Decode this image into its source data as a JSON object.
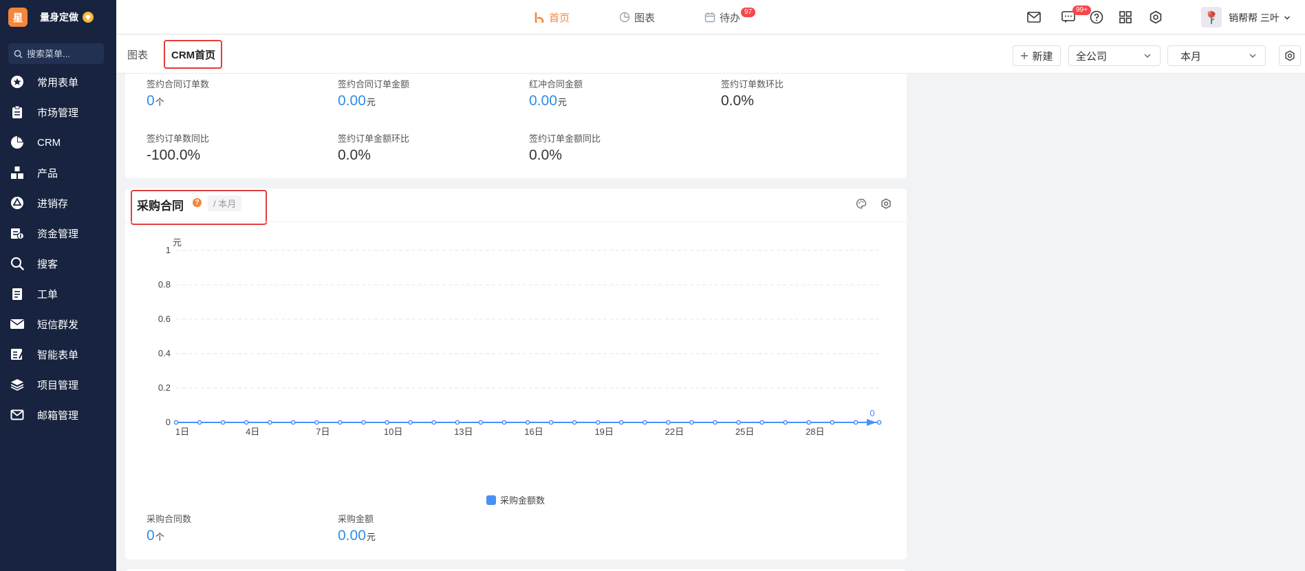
{
  "brand": {
    "logo_char": "星",
    "name": "量身定做"
  },
  "search": {
    "placeholder": "搜索菜单..."
  },
  "sidebar": {
    "items": [
      {
        "label": "常用表单",
        "icon": "star-icon"
      },
      {
        "label": "市场管理",
        "icon": "clipboard-icon"
      },
      {
        "label": "CRM",
        "icon": "pie-icon"
      },
      {
        "label": "产品",
        "icon": "boxes-icon"
      },
      {
        "label": "进销存",
        "icon": "recycle-icon"
      },
      {
        "label": "资金管理",
        "icon": "finance-icon"
      },
      {
        "label": "搜客",
        "icon": "search-icon"
      },
      {
        "label": "工单",
        "icon": "ticket-icon"
      },
      {
        "label": "短信群发",
        "icon": "envelope-icon"
      },
      {
        "label": "智能表单",
        "icon": "form-icon"
      },
      {
        "label": "项目管理",
        "icon": "layers-icon"
      },
      {
        "label": "邮箱管理",
        "icon": "mail-icon"
      }
    ]
  },
  "topnav": {
    "home": "首页",
    "charts": "图表",
    "todo": "待办",
    "todo_badge": "97",
    "message_badge": "99+",
    "user_name": "销帮帮 三叶"
  },
  "subnav": {
    "tab_charts": "图表",
    "tab_crm_home": "CRM首页",
    "new_button": "新建",
    "company_select": "全公司",
    "period_select": "本月"
  },
  "contract_stats": [
    {
      "label": "签约合同订单数",
      "value": "0",
      "unit": "个",
      "highlight": true
    },
    {
      "label": "签约合同订单金额",
      "value": "0.00",
      "unit": "元",
      "highlight": true
    },
    {
      "label": "红冲合同金额",
      "value": "0.00",
      "unit": "元",
      "highlight": true
    },
    {
      "label": "签约订单数环比",
      "value": "0.0%",
      "unit": "",
      "highlight": false
    },
    {
      "label": "签约订单数同比",
      "value": "-100.0%",
      "unit": "",
      "highlight": false
    },
    {
      "label": "签约订单金额环比",
      "value": "0.0%",
      "unit": "",
      "highlight": false
    },
    {
      "label": "签约订单金额同比",
      "value": "0.0%",
      "unit": "",
      "highlight": false
    }
  ],
  "purchase": {
    "title": "采购合同",
    "help": "?",
    "period_tag": "/ 本月",
    "stats": [
      {
        "label": "采购合同数",
        "value": "0",
        "unit": "个"
      },
      {
        "label": "采购金额",
        "value": "0.00",
        "unit": "元"
      }
    ]
  },
  "colors": {
    "accent": "#f5863a",
    "blue": "#2f8de4",
    "series": "#4a8ff7",
    "sidebar": "#17233f"
  },
  "chart_data": {
    "type": "line",
    "ylabel": "元",
    "ylim": [
      0,
      1
    ],
    "y_ticks": [
      "0",
      "0.2",
      "0.4",
      "0.6",
      "0.8",
      "1"
    ],
    "x": [
      "1日",
      "2日",
      "3日",
      "4日",
      "5日",
      "6日",
      "7日",
      "8日",
      "9日",
      "10日",
      "11日",
      "12日",
      "13日",
      "14日",
      "15日",
      "16日",
      "17日",
      "18日",
      "19日",
      "20日",
      "21日",
      "22日",
      "23日",
      "24日",
      "25日",
      "26日",
      "27日",
      "28日",
      "29日",
      "30日",
      "31日"
    ],
    "x_tick_labels": [
      "1日",
      "4日",
      "7日",
      "10日",
      "13日",
      "16日",
      "19日",
      "22日",
      "25日",
      "28日"
    ],
    "series": [
      {
        "name": "采购金额数",
        "values": [
          0,
          0,
          0,
          0,
          0,
          0,
          0,
          0,
          0,
          0,
          0,
          0,
          0,
          0,
          0,
          0,
          0,
          0,
          0,
          0,
          0,
          0,
          0,
          0,
          0,
          0,
          0,
          0,
          0,
          0,
          0
        ]
      }
    ],
    "end_label": "0",
    "grid": true,
    "legend": "bottom-center"
  }
}
